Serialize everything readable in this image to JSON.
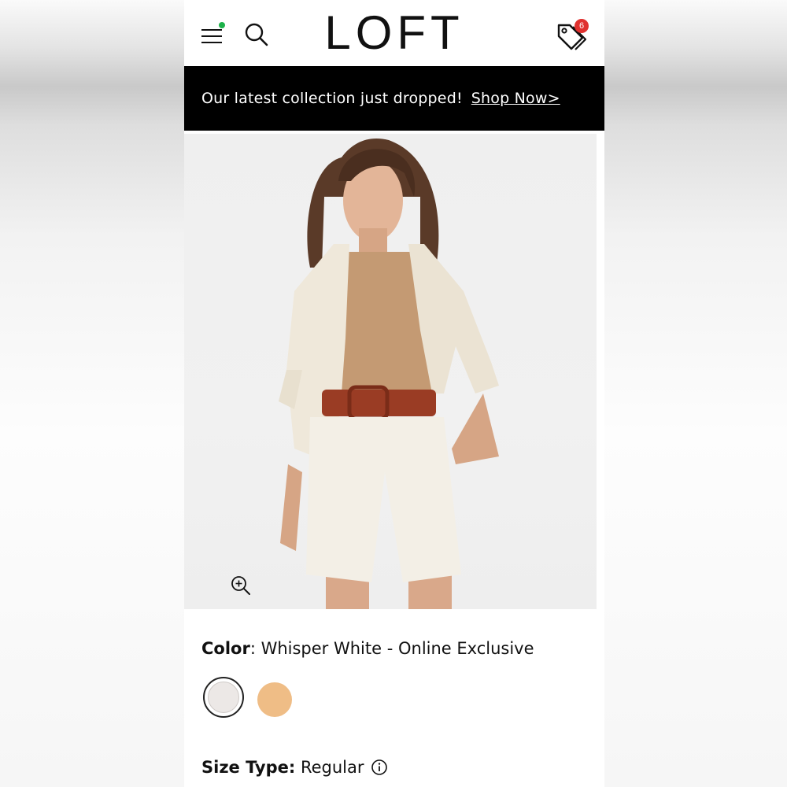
{
  "header": {
    "logo": "LOFT",
    "menu_icon": "hamburger-menu-icon",
    "search_icon": "search-icon",
    "tags_icon": "price-tags-icon",
    "tags_badge": "6",
    "notification_dot_color": "#1db24a",
    "badge_color": "#e0312f"
  },
  "promo": {
    "text": "Our latest collection just dropped!",
    "link": "Shop Now>"
  },
  "hero": {
    "zoom_icon": "zoom-in-icon"
  },
  "color": {
    "label": "Color",
    "value": ": Whisper White - Online Exclusive",
    "swatches": [
      {
        "name": "Whisper White",
        "hex": "#ece8e6",
        "selected": true
      },
      {
        "name": "",
        "hex": "#efbd86",
        "selected": false
      }
    ]
  },
  "size_type": {
    "label": "Size Type:",
    "value": " Regular",
    "info_icon": "info-icon"
  }
}
